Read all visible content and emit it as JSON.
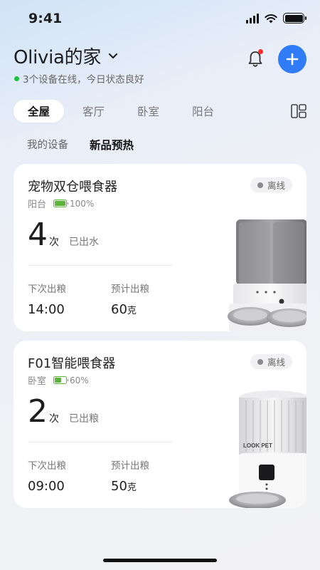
{
  "status_bar": {
    "time": "9:41"
  },
  "header": {
    "home_name": "Olivia的家",
    "subtitle": "3个设备在线，今日状态良好"
  },
  "room_tabs": [
    {
      "label": "全屋",
      "active": true
    },
    {
      "label": "客厅",
      "active": false
    },
    {
      "label": "卧室",
      "active": false
    },
    {
      "label": "阳台",
      "active": false
    }
  ],
  "sub_tabs": [
    {
      "label": "我的设备",
      "active": false
    },
    {
      "label": "新品预热",
      "active": true
    }
  ],
  "devices": [
    {
      "name": "宠物双仓喂食器",
      "status": "离线",
      "room": "阳台",
      "battery": "100%",
      "battery_level": 1.0,
      "count": "4",
      "count_unit": "次",
      "count_desc": "已出水",
      "next_label": "下次出粮",
      "next_value": "14:00",
      "est_label": "预计出粮",
      "est_value": "60",
      "est_unit": "克"
    },
    {
      "name": "F01智能喂食器",
      "status": "离线",
      "room": "卧室",
      "battery": "60%",
      "battery_level": 0.6,
      "count": "2",
      "count_unit": "次",
      "count_desc": "已出粮",
      "next_label": "下次出粮",
      "next_value": "09:00",
      "est_label": "预计出粮",
      "est_value": "50",
      "est_unit": "克",
      "product_brand": "LOOK PET"
    }
  ],
  "colors": {
    "accent": "#2f7cf6",
    "online_dot": "#22c03c",
    "battery": "#5bb33a",
    "badge": "#ff2d2d"
  }
}
